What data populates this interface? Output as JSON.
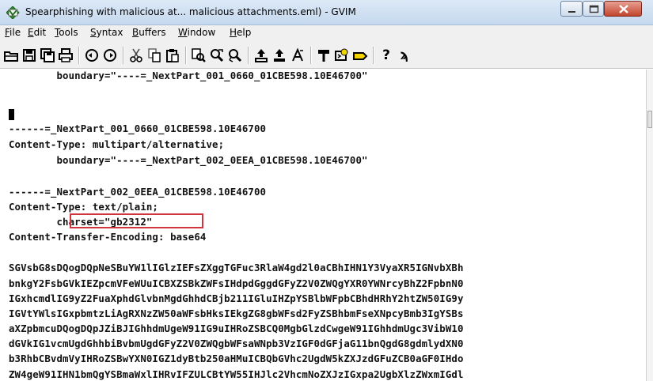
{
  "window": {
    "title": "Spearphishing with malicious at... malicious attachments.eml) - GVIM",
    "controls": {
      "minimize_icon": "minimize-icon",
      "maximize_icon": "maximize-icon",
      "close_icon": "close-icon"
    },
    "close_color": "#c2452d"
  },
  "menu": [
    {
      "label": "File",
      "key": "F",
      "rest": "ile"
    },
    {
      "label": "Edit",
      "key": "E",
      "rest": "dit"
    },
    {
      "label": "Tools",
      "key": "T",
      "rest": "ools"
    },
    {
      "label": "Syntax",
      "key": "S",
      "rest": "yntax"
    },
    {
      "label": "Buffers",
      "key": "B",
      "rest": "uffers"
    },
    {
      "label": "Window",
      "key": "W",
      "rest": "indow"
    },
    {
      "label": "Help",
      "key": "H",
      "rest": "elp"
    }
  ],
  "toolbar": {
    "icons": [
      "open-icon",
      "save-icon",
      "save-all-icon",
      "print-icon",
      "undo-icon",
      "redo-icon",
      "cut-icon",
      "copy-icon",
      "paste-icon",
      "replace-icon",
      "find-next-icon",
      "find-prev-icon",
      "load-session-icon",
      "save-session-icon",
      "run-script-icon",
      "make-icon",
      "shell-icon",
      "ctags-icon",
      "help-icon",
      "find-help-icon"
    ],
    "help_glyph": "?",
    "find_help_glyph": "ϡ"
  },
  "editor": {
    "lines": [
      "        boundary=\"----=_NextPart_001_0660_01CBE598.10E46700\"",
      "",
      "------=_NextPart_001_0660_01CBE598.10E46700",
      "Content-Type: multipart/alternative;",
      "        boundary=\"----=_NextPart_002_0EEA_01CBE598.10E46700\"",
      "",
      "------=_NextPart_002_0EEA_01CBE598.10E46700",
      "Content-Type: text/plain;",
      "        charset=\"gb2312\"",
      "Content-Transfer-Encoding: base64",
      "",
      "SGVsbG8sDQogDQpNeSBuYW1lIGlzIEFsZXggTGFuc3RlaW4gd2l0aCBhIHN1Y3VyaXR5IGNvbXBh",
      "bnkgY2FsbGVkIEZpcmVFeWUuICBXZSBkZWFsIHdpdGggdGFyZ2V0ZWQgYXR0YWNrcyBhZ2FpbnN0",
      "IGxhcmdlIG9yZ2FuaXphdGlvbnMgdGhhdCBjb211IGluIHZpYSBlbWFpbCBhdHRhY2htZW50IG9y",
      "IGVtYWlsIGxpbmtzLiAgRXNzZW50aWFsbHksIEkgZG8gbWFsd2FyZSBhbmFseXNpcyBmb3IgYSBs",
      "aXZpbmcuDQogDQpJZiBJIGhhdmUgeW91IG9uIHRoZSBCQ0MgbGlzdCwgeW91IGhhdmUgc3VibW10",
      "dGVkIG1vcmUgdGhhbiBvbmUgdGFyZ2V0ZWQgbWFsaWNpb3VzIGF0dGFjaG11bnQgdG8gdmlydXN0",
      "b3RhbCBvdmVyIHRoZSBwYXN0IGZ1dyBtb250aHMuICBQbGVhc2UgdW5kZXJzdGFuZCB0aGF0IHdo",
      "ZW4geW91IHN1bmQgYSBmaWxlIHRvIFZULCBtYW55IHJlc2VhcmNoZXJzIGxpa2UgbXlzZWxmIGdl"
    ],
    "highlight_label": "charset=\"gb2312\"",
    "highlight_color": "#d0343f"
  }
}
